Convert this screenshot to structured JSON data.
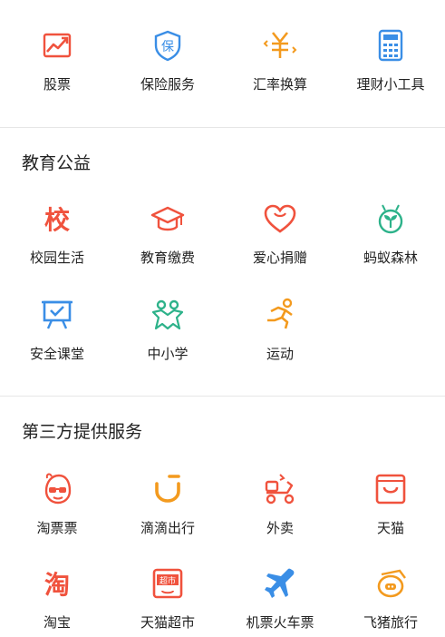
{
  "finance": {
    "items": [
      {
        "label": "股票",
        "icon": "stock-chart-icon",
        "color": "#f0523d"
      },
      {
        "label": "保险服务",
        "icon": "insurance-shield-icon",
        "color": "#3a8ee6",
        "glyph": "保"
      },
      {
        "label": "汇率换算",
        "icon": "yen-exchange-icon",
        "color": "#f39a1e"
      },
      {
        "label": "理财小工具",
        "icon": "calculator-icon",
        "color": "#3a8ee6"
      }
    ]
  },
  "education": {
    "title": "教育公益",
    "items": [
      {
        "label": "校园生活",
        "icon": "school-glyph-icon",
        "color": "#f0523d",
        "glyph": "校"
      },
      {
        "label": "教育缴费",
        "icon": "graduation-cap-icon",
        "color": "#f0523d"
      },
      {
        "label": "爱心捐赠",
        "icon": "heart-icon",
        "color": "#f0523d"
      },
      {
        "label": "蚂蚁森林",
        "icon": "sprout-icon",
        "color": "#2db28a"
      },
      {
        "label": "安全课堂",
        "icon": "classroom-board-icon",
        "color": "#3a8ee6"
      },
      {
        "label": "中小学",
        "icon": "kids-icon",
        "color": "#2db28a"
      },
      {
        "label": "运动",
        "icon": "running-icon",
        "color": "#f39a1e"
      }
    ]
  },
  "third_party": {
    "title": "第三方提供服务",
    "items": [
      {
        "label": "淘票票",
        "icon": "taopiaopiao-icon",
        "color": "#f0523d"
      },
      {
        "label": "滴滴出行",
        "icon": "didi-icon",
        "color": "#f39a1e"
      },
      {
        "label": "外卖",
        "icon": "scooter-icon",
        "color": "#f0523d"
      },
      {
        "label": "天猫",
        "icon": "tmall-icon",
        "color": "#f0523d"
      },
      {
        "label": "淘宝",
        "icon": "taobao-icon",
        "color": "#f0523d",
        "glyph": "淘"
      },
      {
        "label": "天猫超市",
        "icon": "tmall-supermarket-icon",
        "color": "#f0523d",
        "glyph": "超市"
      },
      {
        "label": "机票火车票",
        "icon": "airplane-icon",
        "color": "#3a8ee6"
      },
      {
        "label": "飞猪旅行",
        "icon": "fliggy-icon",
        "color": "#f39a1e"
      }
    ]
  }
}
